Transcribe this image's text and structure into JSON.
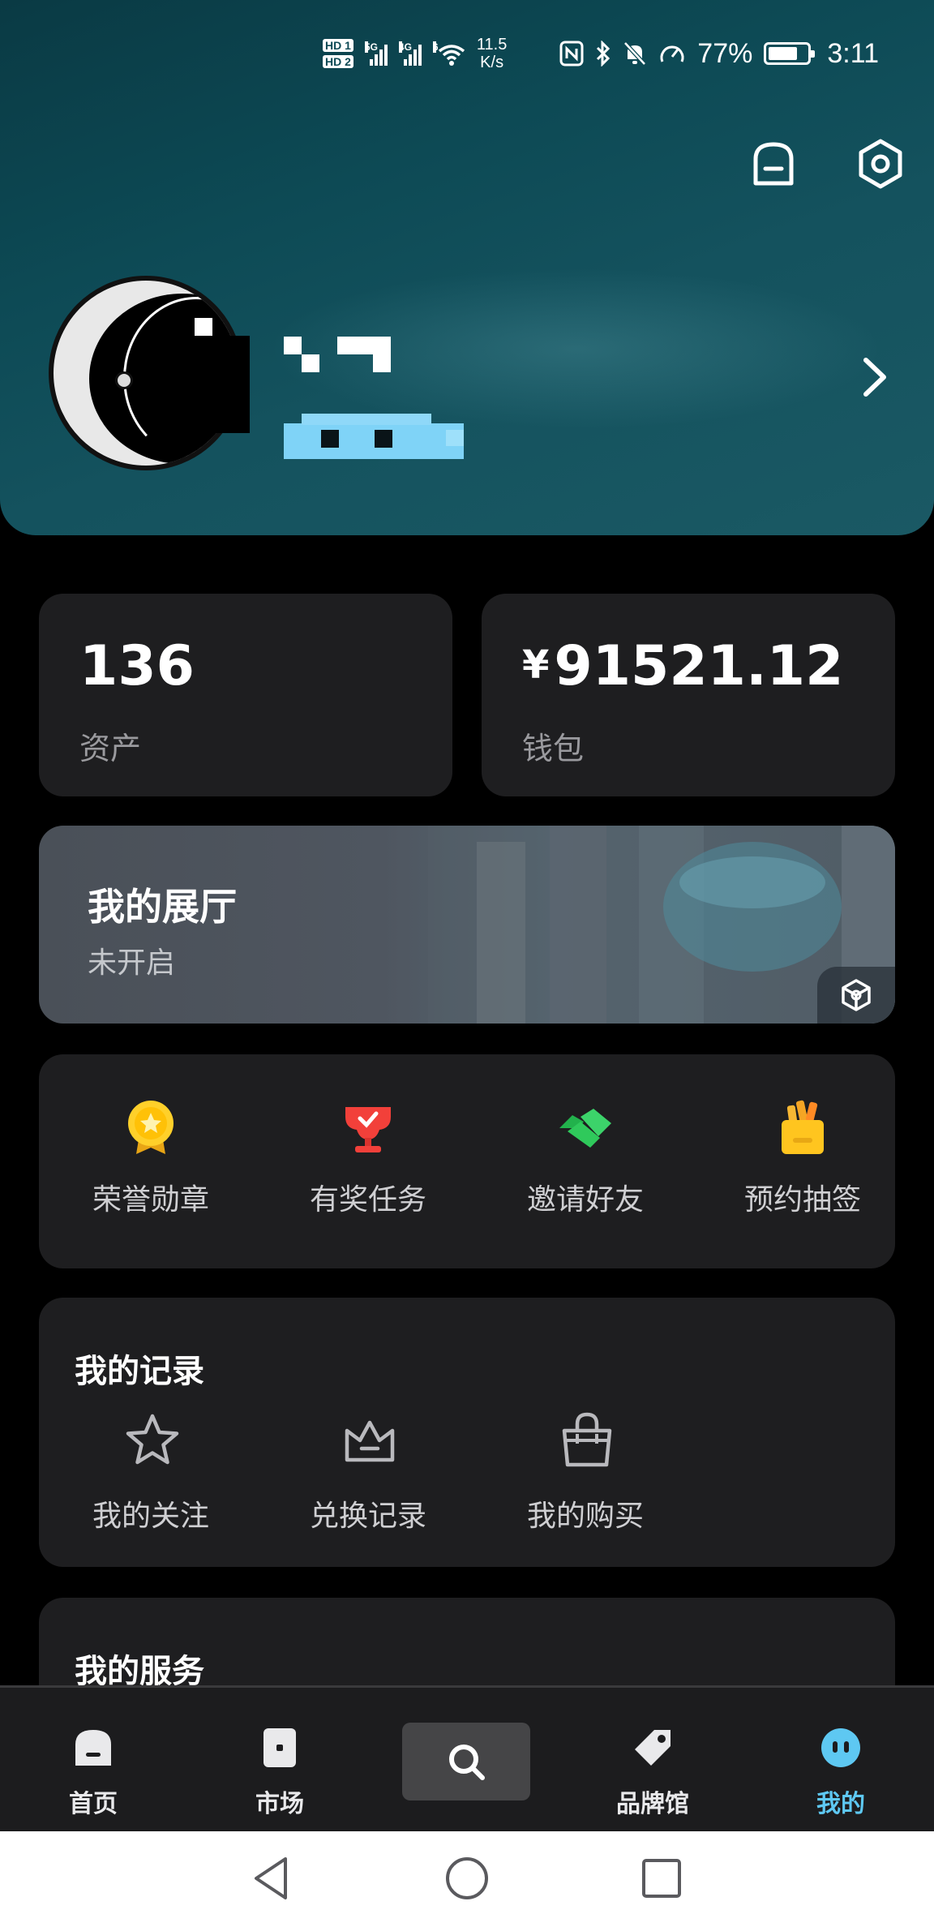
{
  "status_bar": {
    "hd1": "HD 1",
    "hd2": "HD 2",
    "net1": "5G",
    "net2": "4G",
    "wifi": "6",
    "speed_value": "11.5",
    "speed_unit": "K/s",
    "battery_percent": "77%",
    "battery_level": 0.77,
    "time": "3:11"
  },
  "stats": {
    "assets_value": "136",
    "assets_label": "资产",
    "wallet_currency": "¥",
    "wallet_value": "91521.12",
    "wallet_label": "钱包"
  },
  "gallery": {
    "title": "我的展厅",
    "status": "未开启"
  },
  "quick_actions": [
    {
      "label": "荣誉勋章",
      "icon": "medal-icon"
    },
    {
      "label": "有奖任务",
      "icon": "trophy-icon"
    },
    {
      "label": "邀请好友",
      "icon": "handshake-icon"
    },
    {
      "label": "预约抽签",
      "icon": "lottery-bag-icon"
    }
  ],
  "records": {
    "title": "我的记录",
    "items": [
      {
        "label": "我的关注",
        "icon": "star-icon"
      },
      {
        "label": "兑换记录",
        "icon": "crown-icon"
      },
      {
        "label": "我的购买",
        "icon": "shopping-bag-icon"
      }
    ]
  },
  "services": {
    "title": "我的服务"
  },
  "tabbar": {
    "items": [
      {
        "label": "首页",
        "icon": "home-icon"
      },
      {
        "label": "市场",
        "icon": "market-icon"
      },
      {
        "label": "",
        "icon": "search-icon"
      },
      {
        "label": "品牌馆",
        "icon": "tag-icon"
      },
      {
        "label": "我的",
        "icon": "profile-icon"
      }
    ],
    "active_color": "#5ec8f2"
  },
  "colors": {
    "card_bg": "#1e1e20",
    "header_teal": "#0d4a55",
    "label_gray": "#9a9a9e"
  }
}
